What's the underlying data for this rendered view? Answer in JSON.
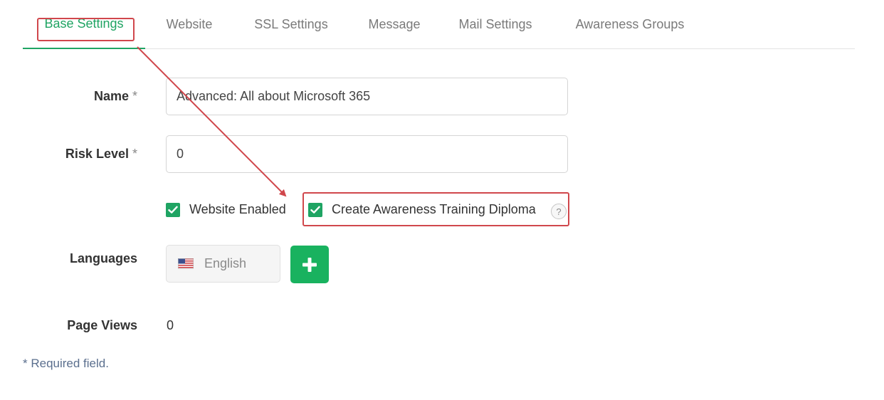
{
  "tabs": [
    {
      "label": "Base Settings",
      "active": true
    },
    {
      "label": "Website",
      "active": false
    },
    {
      "label": "SSL Settings",
      "active": false
    },
    {
      "label": "Message",
      "active": false
    },
    {
      "label": "Mail Settings",
      "active": false
    },
    {
      "label": "Awareness Groups",
      "active": false
    }
  ],
  "form": {
    "name_label": "Name",
    "name_value": "Advanced: All about Microsoft 365",
    "risk_label": "Risk Level",
    "risk_value": "0",
    "required_marker": "*",
    "website_enabled_label": "Website Enabled",
    "website_enabled_checked": true,
    "diploma_label": "Create Awareness Training Diploma",
    "diploma_checked": true,
    "help_symbol": "?",
    "languages_label": "Languages",
    "language_value": "English",
    "page_views_label": "Page Views",
    "page_views_value": "0",
    "required_note": "* Required field."
  },
  "colors": {
    "accent_green": "#1fa463",
    "add_button_green": "#19b25f",
    "highlight_red": "#d0474c"
  },
  "icons": {
    "check": "check-icon",
    "add": "plus-icon",
    "flag": "us-flag-icon",
    "help": "help-icon"
  }
}
